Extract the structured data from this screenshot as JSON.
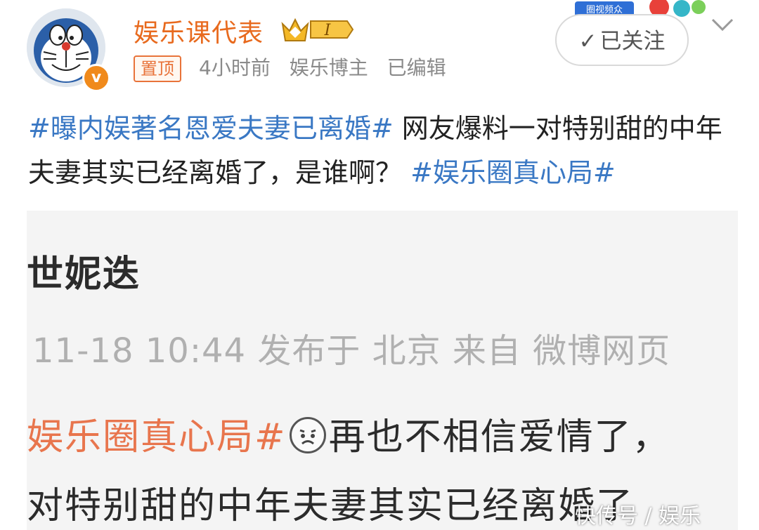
{
  "header": {
    "username": "娱乐课代表",
    "vip_level": "I",
    "pinned_label": "置顶",
    "time": "4小时前",
    "role": "娱乐博主",
    "edited": "已编辑",
    "follow_label": "已关注",
    "verified_mark": "v",
    "promo_text": "圈视频众"
  },
  "post": {
    "tag1": "#曝内娱著名恩爱夫妻已离婚#",
    "body": " 网友爆料一对特别甜的中年夫妻其实已经离婚了，是谁啊？ ",
    "tag2": "#娱乐圈真心局#"
  },
  "embed": {
    "name": "世妮迭",
    "meta": "11-18 10:44 发布于 北京 来自 微博网页",
    "tag": "娱乐圈真心局#",
    "line1_text": "再也不相信爱情了，",
    "line2": "对特别甜的中年夫妻其实已经离婚了"
  },
  "watermark": "快传号 / 娱乐"
}
